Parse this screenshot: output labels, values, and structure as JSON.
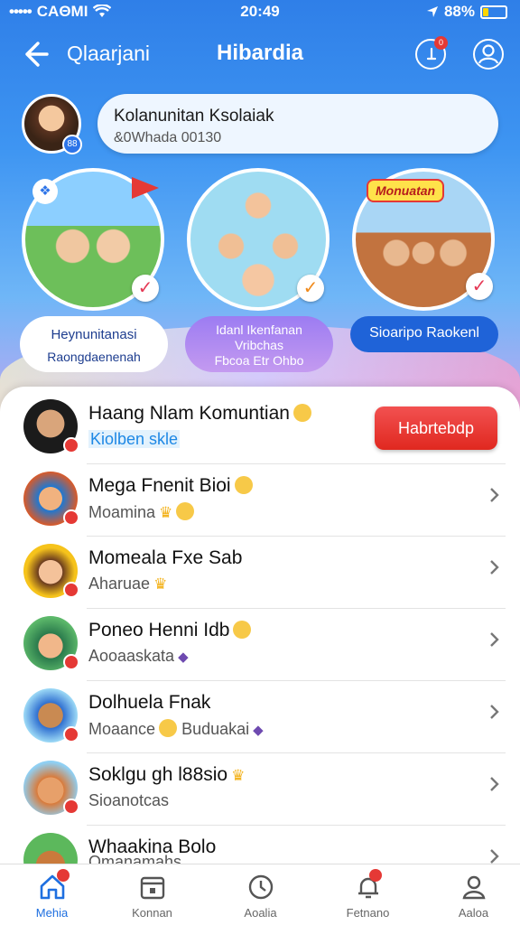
{
  "status_bar": {
    "carrier": "CAΘMI",
    "signal_dots": "•••••",
    "time": "20:49",
    "battery": "88%"
  },
  "header": {
    "back_label": "Qlaarjani",
    "title": "Hibardia",
    "notif_badge": "0"
  },
  "user_card": {
    "name": "Kolanunitan Ksolaiak",
    "meta": "&0Whada 00130",
    "avatar_badge": "88"
  },
  "tiles": [
    {
      "line1": "Heynunitanasi",
      "line2": "Raongdaenenah",
      "style": "white"
    },
    {
      "line1": "Idanl Ikenfanan",
      "line2": "Vribchas",
      "line3": "Fbcoa Etr Ohbo",
      "style": "purple"
    },
    {
      "line1": "Sioaripo Raokenl",
      "tag": "Monuatan",
      "style": "blue"
    }
  ],
  "list": [
    {
      "name": "Haang Nlam Komuntian",
      "sub": "Kiolben skle",
      "action": "Habrtebdp",
      "sub_link": true
    },
    {
      "name": "Mega Fnenit Bioi",
      "sub": "Moamina"
    },
    {
      "name": "Momeala Fxe Sab",
      "sub": "Aharuae"
    },
    {
      "name": "Poneo Henni Idb",
      "sub": "Aooaaskata"
    },
    {
      "name": "Dolhuela Fnak",
      "sub": "Moaance",
      "sub2": "Buduakai"
    },
    {
      "name": "Soklgu gh l88sio",
      "sub": "Sioanotcas"
    },
    {
      "name": "Whaakina Bolo",
      "sub": "Omanamahs"
    }
  ],
  "tabs": [
    {
      "label": "Mehia",
      "icon": "home-icon",
      "active": true
    },
    {
      "label": "Konnan",
      "icon": "calendar-icon"
    },
    {
      "label": "Aoalia",
      "icon": "clock-icon"
    },
    {
      "label": "Fetnano",
      "icon": "bell-icon"
    },
    {
      "label": "Aaloa",
      "icon": "person-icon"
    }
  ],
  "colors": {
    "primary": "#2f7fe8",
    "accent_red": "#e53935",
    "active_tab": "#1e6fe0"
  }
}
